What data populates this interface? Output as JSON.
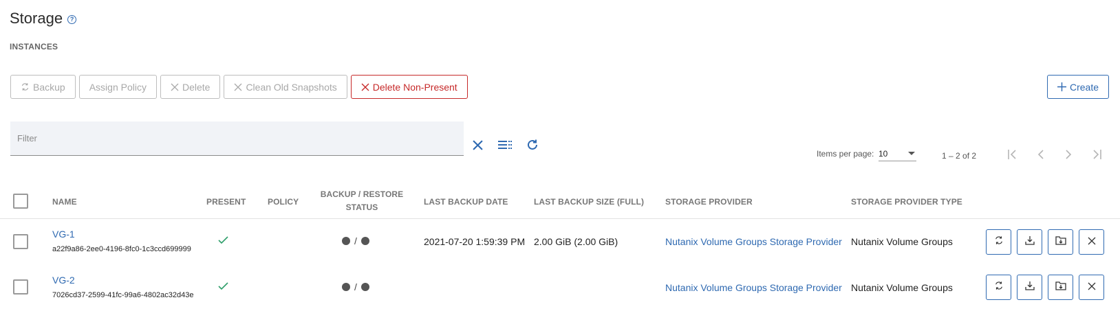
{
  "page": {
    "title": "Storage",
    "subtitle": "INSTANCES"
  },
  "toolbar": {
    "backup_label": "Backup",
    "assign_policy_label": "Assign Policy",
    "delete_label": "Delete",
    "clean_label": "Clean Old Snapshots",
    "delete_non_present_label": "Delete Non-Present",
    "create_label": "Create"
  },
  "filter": {
    "placeholder": "Filter",
    "value": ""
  },
  "pagination": {
    "items_per_page_label": "Items per page:",
    "items_per_page_value": "10",
    "range_label": "1 – 2 of 2"
  },
  "table": {
    "columns": {
      "name": "NAME",
      "present": "PRESENT",
      "policy": "POLICY",
      "status_line1": "BACKUP / RESTORE",
      "status_line2": "STATUS",
      "last_backup_date": "LAST BACKUP DATE",
      "last_backup_size": "LAST BACKUP SIZE (FULL)",
      "storage_provider": "STORAGE PROVIDER",
      "storage_provider_type": "STORAGE PROVIDER TYPE"
    },
    "rows": [
      {
        "name": "VG-1",
        "uuid": "a22f9a86-2ee0-4196-8fc0-1c3ccd699999",
        "present": "✓",
        "policy": "",
        "status_sep": "/",
        "last_backup_date": "2021-07-20 1:59:39 PM",
        "last_backup_size": "2.00 GiB (2.00 GiB)",
        "storage_provider": "Nutanix Volume Groups Storage Provider",
        "storage_provider_type": "Nutanix Volume Groups"
      },
      {
        "name": "VG-2",
        "uuid": "7026cd37-2599-41fc-99a6-4802ac32d43e",
        "present": "✓",
        "policy": "",
        "status_sep": "/",
        "last_backup_date": "",
        "last_backup_size": "",
        "storage_provider": "Nutanix Volume Groups Storage Provider",
        "storage_provider_type": "Nutanix Volume Groups"
      }
    ]
  },
  "colors": {
    "accent": "#2e69b1",
    "danger": "#c62828",
    "success": "#2e9e6a",
    "disabled": "#a8a8a8"
  },
  "icons": {
    "help": "help-circle-icon",
    "backup": "sync-icon",
    "delete": "close-icon",
    "create": "plus-icon",
    "clear_filter": "close-icon",
    "columns": "column-list-icon",
    "refresh": "refresh-icon",
    "row_backup": "sync-icon",
    "row_restore": "download-icon",
    "row_restore_folder": "folder-download-icon",
    "row_delete": "close-icon"
  }
}
